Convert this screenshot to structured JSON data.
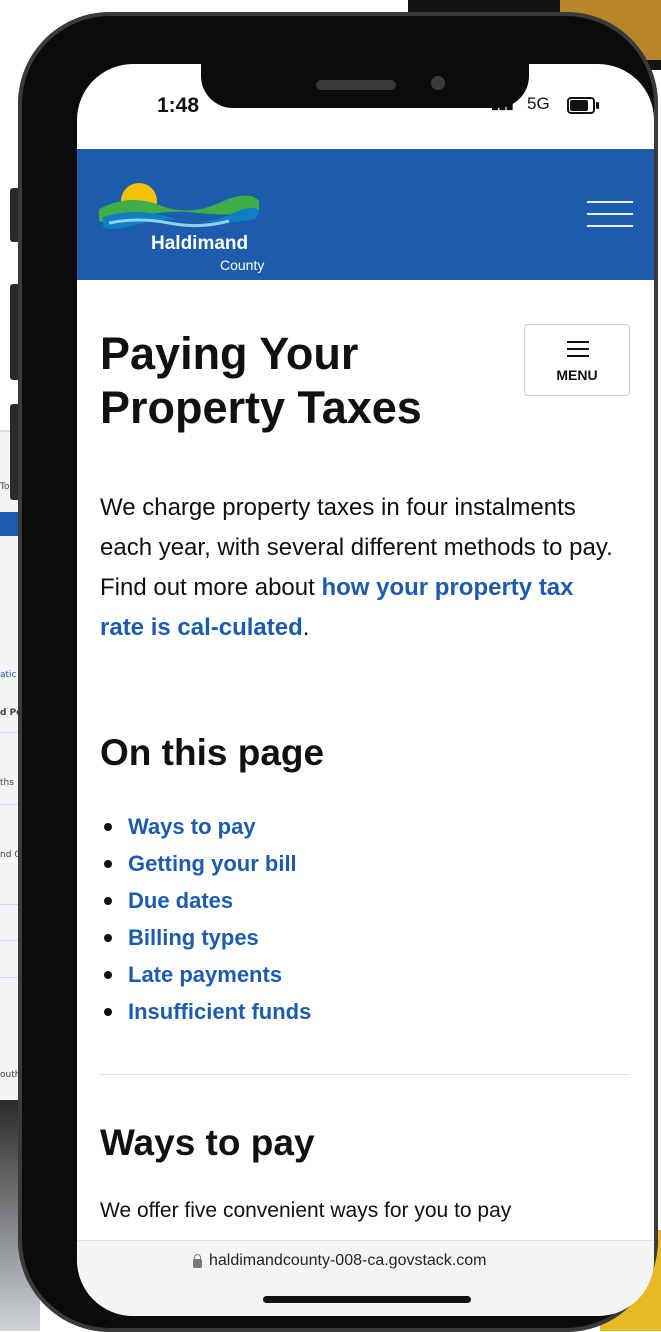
{
  "status_bar": {
    "time": "1:48",
    "signal": "▮▮▮",
    "network": "5G"
  },
  "header": {
    "logo_name": "Haldimand",
    "logo_sub": "County",
    "colors": {
      "header_bg": "#1d5cad",
      "sun": "#f4c20d",
      "wave_green": "#3fae49",
      "wave_blue": "#0f7fc1"
    }
  },
  "page": {
    "title": "Paying Your Property Taxes",
    "menu_label": "MENU",
    "intro_text": "We charge property taxes in four instalments each year, with several different methods to pay. Find out more about ",
    "intro_link": "how your property tax rate is cal-culated",
    "intro_end": ".",
    "on_this_page_heading": "On this page",
    "toc_items": [
      "Ways to pay",
      "Getting your bill",
      "Due dates",
      "Billing types",
      "Late payments",
      "Insufficient funds"
    ],
    "ways_heading": "Ways to pay",
    "ways_text": "We offer five convenient ways for you to pay"
  },
  "browser": {
    "url": "haldimandcounty-008-ca.govstack.com"
  },
  "background_laptop": {
    "snippets": [
      "To",
      "atic",
      "d Po",
      "ths",
      "nd C",
      "outh"
    ]
  }
}
